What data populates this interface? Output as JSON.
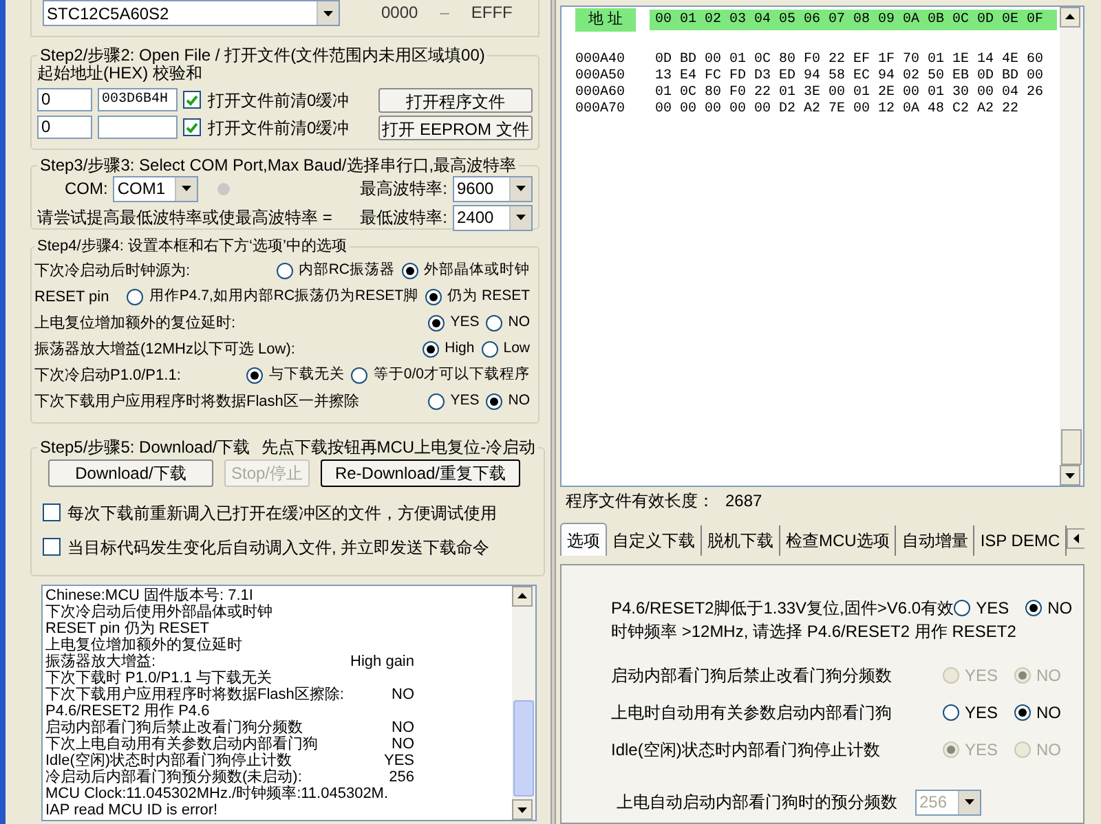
{
  "device": {
    "model": "STC12C5A60S2",
    "range_start": "0000",
    "range_sep": "–",
    "range_end": "EFFF"
  },
  "step2": {
    "title": "Step2/步骤2: Open File / 打开文件(文件范围内未用区域填00)",
    "address_label": "起始地址(HEX) 校验和",
    "rows": [
      {
        "address": "0",
        "checksum": "003D6B4H",
        "clear_label": "打开文件前清0缓冲",
        "checked": true,
        "button": "打开程序文件"
      },
      {
        "address": "0",
        "clear_label": "打开文件前清0缓冲",
        "checked": true,
        "button": "打开 EEPROM 文件"
      }
    ]
  },
  "step3": {
    "title": "Step3/步骤3: Select COM Port,Max Baud/选择串行口,最高波特率",
    "com_label": "COM:",
    "com": "COM1",
    "max_label": "最高波特率:",
    "max": "9600",
    "hint": "请尝试提高最低波特率或使最高波特率 =",
    "min_label": "最低波特率:",
    "min": "2400"
  },
  "step4": {
    "title": "Step4/步骤4: 设置本框和右下方‘选项’中的选项",
    "options": [
      {
        "label": "下次冷启动后时钟源为:",
        "choices": [
          {
            "label": "内部RC振荡器",
            "selected": false
          },
          {
            "label": "外部晶体或时钟",
            "selected": true
          }
        ]
      },
      {
        "label": "RESET pin",
        "choices": [
          {
            "label": "用作P4.7,如用内部RC振荡仍为RESET脚",
            "selected": false
          },
          {
            "label": "仍为 RESET",
            "selected": true
          }
        ]
      },
      {
        "label": "上电复位增加额外的复位延时:",
        "choices": [
          {
            "label": "YES",
            "selected": true
          },
          {
            "label": "NO",
            "selected": false
          }
        ]
      },
      {
        "label": "振荡器放大增益(12MHz以下可选 Low):",
        "choices": [
          {
            "label": "High",
            "selected": true
          },
          {
            "label": "Low",
            "selected": false
          }
        ]
      },
      {
        "label": "下次冷启动P1.0/P1.1:",
        "choices": [
          {
            "label": "与下载无关",
            "selected": true
          },
          {
            "label": "等于0/0才可以下载程序",
            "selected": false
          }
        ]
      },
      {
        "label": "下次下载用户应用程序时将数据Flash区一并擦除",
        "choices": [
          {
            "label": "YES",
            "selected": false
          },
          {
            "label": "NO",
            "selected": true
          }
        ]
      }
    ]
  },
  "step5": {
    "title": "Step5/步骤5: Download/下载",
    "note": "先点下载按钮再MCU上电复位-冷启动",
    "buttons": [
      {
        "label": "Download/下载",
        "disabled": false
      },
      {
        "label": "Stop/停止",
        "disabled": true
      },
      {
        "label": "Re-Download/重复下载",
        "disabled": false
      }
    ],
    "checks": [
      {
        "label": "每次下载前重新调入已打开在缓冲区的文件，方便调试使用",
        "checked": false
      },
      {
        "label": "当目标代码发生变化后自动调入文件, 并立即发送下载命令",
        "checked": false
      }
    ]
  },
  "log": {
    "lines": [
      {
        "text": "Chinese:MCU 固件版本号: 7.1I"
      },
      {
        "text": "下次冷启动后使用外部晶体或时钟"
      },
      {
        "text": "RESET pin 仍为 RESET"
      },
      {
        "text": "上电复位增加额外的复位延时"
      },
      {
        "text": "振荡器放大增益:",
        "value": "High gain"
      },
      {
        "text": "下次下载时 P1.0/P1.1 与下载无关"
      },
      {
        "text": "下次下载用户应用程序时将数据Flash区擦除:",
        "value": "NO"
      },
      {
        "text": "P4.6/RESET2 用作 P4.6"
      },
      {
        "text": "启动内部看门狗后禁止改看门狗分频数",
        "value": "NO"
      },
      {
        "text": "下次上电自动用有关参数启动内部看门狗",
        "value": "NO"
      },
      {
        "text": "Idle(空闲)状态时内部看门狗停止计数",
        "value": "YES"
      },
      {
        "text": "冷启动后内部看门狗预分频数(未启动):",
        "value": "256"
      },
      {
        "text": "MCU Clock:11.045302MHz./时钟频率:11.045302M."
      },
      {
        "text": "IAP read MCU ID is error!"
      }
    ]
  },
  "hex": {
    "address_header": "地 址",
    "column_header": "00 01 02 03 04 05 06 07 08 09 0A 0B 0C 0D 0E 0F",
    "rows": [
      {
        "address": "000A40",
        "bytes": "0D BD 00 01 0C 80 F0 22 EF 1F 70 01 1E 14 4E 60"
      },
      {
        "address": "000A50",
        "bytes": "13 E4 FC FD D3 ED 94 58 EC 94 02 50 EB 0D BD 00"
      },
      {
        "address": "000A60",
        "bytes": "01 0C 80 F0 22 01 3E 00 01 2E 00 01 30 00 04 26"
      },
      {
        "address": "000A70",
        "bytes": "00 00 00 00 00 D2 A2 7E 00 12 0A 48 C2 A2 22"
      }
    ]
  },
  "file_length": {
    "label": "程序文件有效长度：",
    "value": "2687"
  },
  "tabs": [
    {
      "label": "选项",
      "selected": true
    },
    {
      "label": "自定义下载",
      "selected": false
    },
    {
      "label": "脱机下载",
      "selected": false
    },
    {
      "label": "检查MCU选项",
      "selected": false
    },
    {
      "label": "自动增量",
      "selected": false
    },
    {
      "label": "ISP DEMC",
      "selected": false
    }
  ],
  "options": {
    "reset2": {
      "label": "P4.6/RESET2脚低于1.33V复位,固件>V6.0有效",
      "choices": [
        {
          "label": "YES",
          "selected": false
        },
        {
          "label": "NO",
          "selected": true
        }
      ]
    },
    "note": "时钟频率 >12MHz, 请选择 P4.6/RESET2 用作 RESET2",
    "watchdog": [
      {
        "label": "启动内部看门狗后禁止改看门狗分频数",
        "disabled": true,
        "choices": [
          {
            "label": "YES",
            "selected": false
          },
          {
            "label": "NO",
            "selected": true
          }
        ]
      },
      {
        "label": "上电时自动用有关参数启动内部看门狗",
        "disabled": false,
        "choices": [
          {
            "label": "YES",
            "selected": false
          },
          {
            "label": "NO",
            "selected": true
          }
        ]
      },
      {
        "label": "Idle(空闲)状态时内部看门狗停止计数",
        "disabled": true,
        "choices": [
          {
            "label": "YES",
            "selected": true
          },
          {
            "label": "NO",
            "selected": false
          }
        ]
      }
    ],
    "prescale": {
      "label": "上电自动启动内部看门狗时的预分频数",
      "value": "256",
      "disabled": true
    }
  }
}
